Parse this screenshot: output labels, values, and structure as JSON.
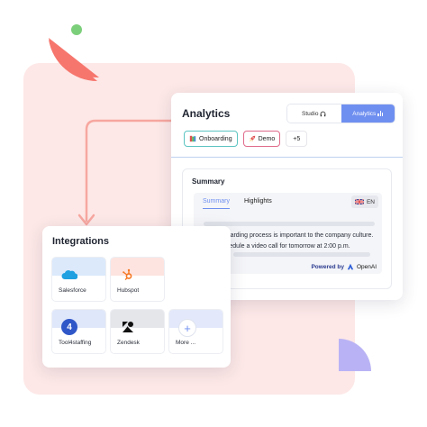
{
  "analytics": {
    "title": "Analytics",
    "segmented": {
      "studio_label": "Studio",
      "analytics_label": "Analytics",
      "selected": "Analytics"
    },
    "tags": [
      {
        "label": "Onboarding",
        "icon": "book-stack-icon"
      },
      {
        "label": "Demo",
        "icon": "rocket-icon"
      }
    ],
    "more_tags": "+5",
    "summary": {
      "title": "Summary",
      "tabs": [
        "Summary",
        "Highlights"
      ],
      "active_tab": "Summary",
      "language": "EN",
      "text": "The onboarding process is important to the company culture. They schedule a video call for tomorrow at 2:00 p.m.",
      "powered_by": "Powered by",
      "provider": "OpenAI"
    }
  },
  "integrations": {
    "title": "Integrations",
    "items": [
      {
        "label": "Salesforce",
        "icon": "salesforce-cloud-icon",
        "band_color": "#dbe9fb"
      },
      {
        "label": "Hubspot",
        "icon": "hubspot-icon",
        "band_color": "#fde4e0"
      },
      {
        "label": "Tool4staffing",
        "icon": "tool4staffing-icon",
        "band_color": "#dfe7fa"
      },
      {
        "label": "Zendesk",
        "icon": "zendesk-icon",
        "band_color": "#e5e6ea"
      },
      {
        "label": "More ...",
        "icon": "plus-icon",
        "band_color": "#e3e9fb"
      }
    ]
  },
  "colors": {
    "accent": "#6f8ff0",
    "background_panel": "#fde8e7",
    "connector": "#f7a7a0",
    "onboarding_border": "#5bc4c1",
    "demo_border": "#e06a8a"
  }
}
